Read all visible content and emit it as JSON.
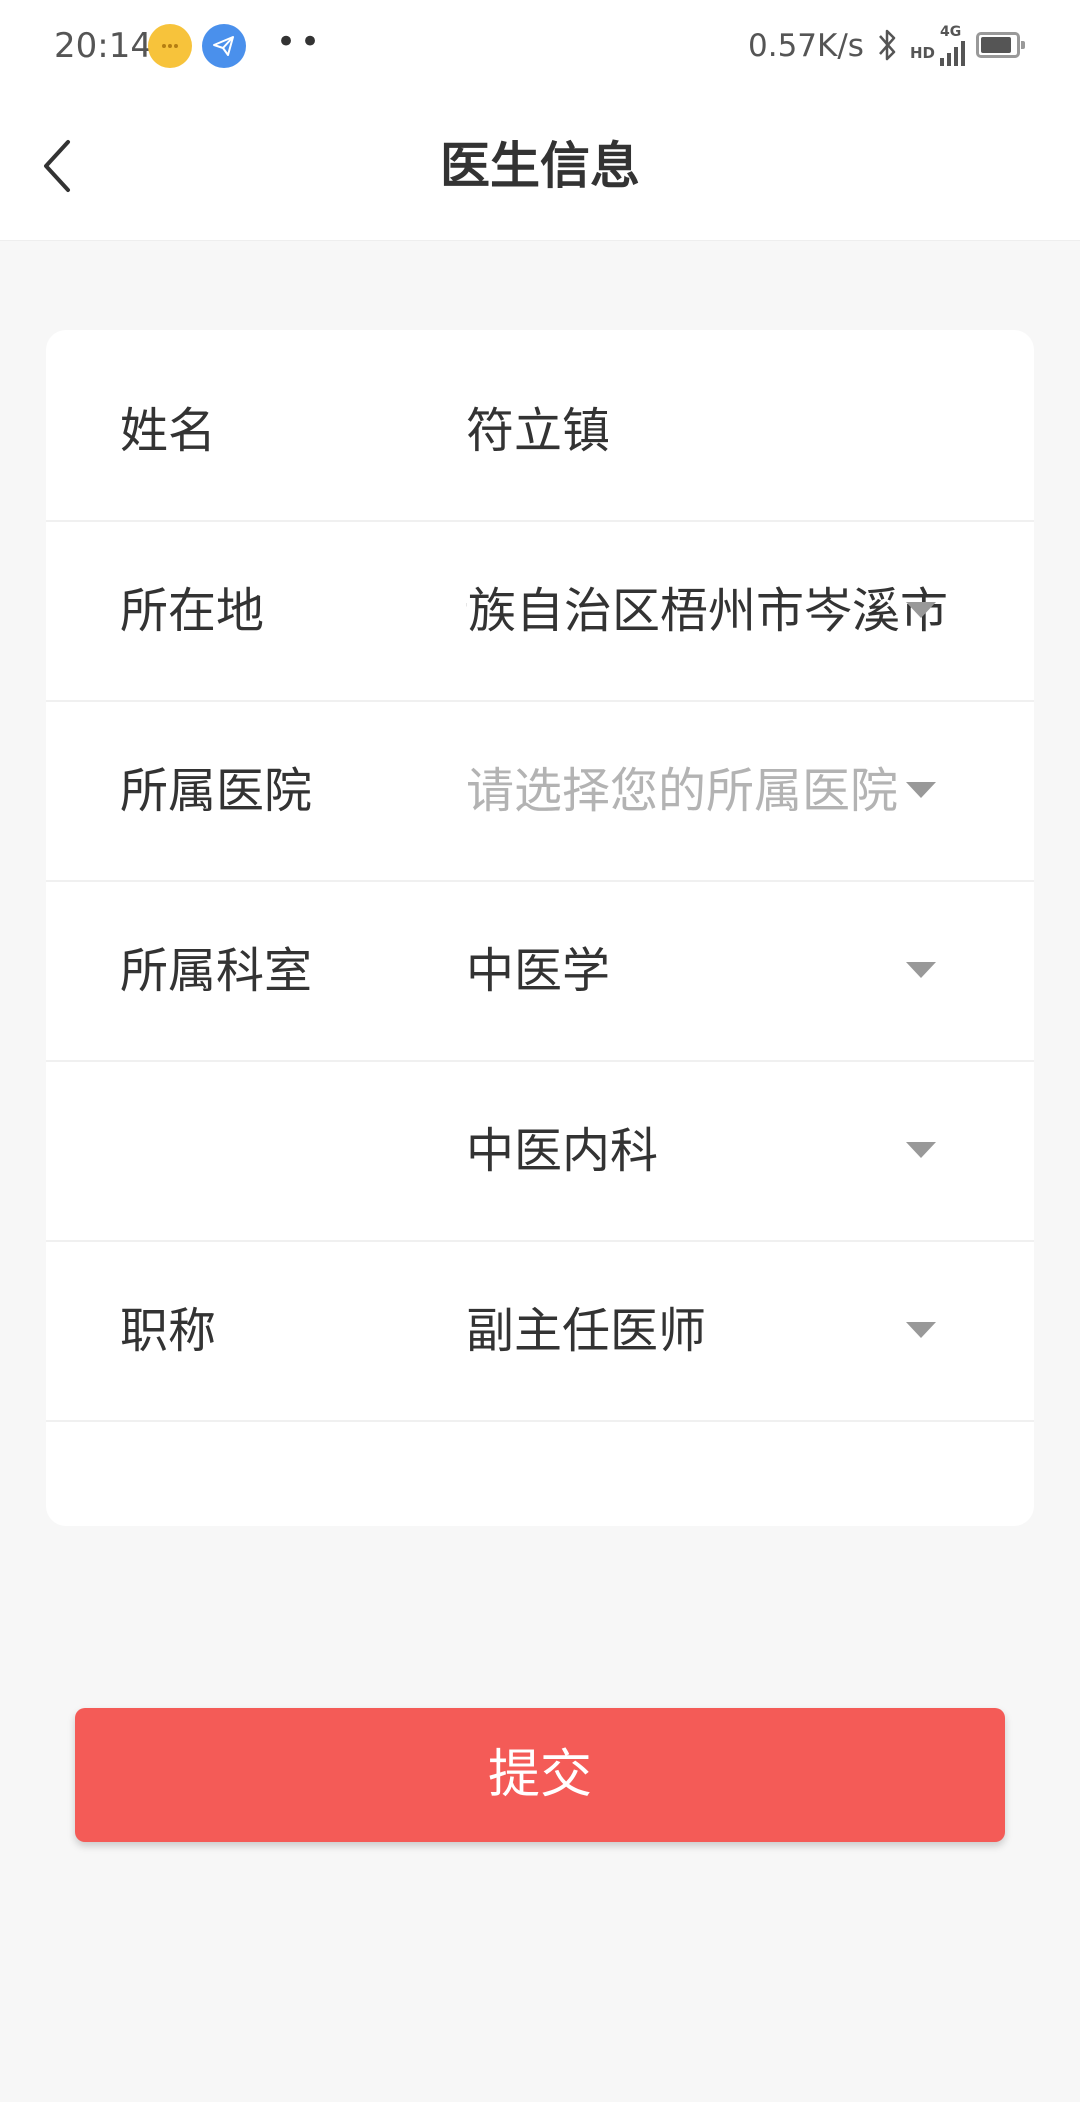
{
  "status_bar": {
    "time": "20:14",
    "net_speed": "0.57K/s",
    "network_hd": "HD",
    "network_gen": "4G",
    "dots": "••",
    "icons": [
      "chat-bubble-icon",
      "telegram-icon",
      "bluetooth-icon",
      "signal-icon",
      "battery-icon"
    ]
  },
  "header": {
    "title": "医生信息",
    "back_icon": "chevron-left-icon"
  },
  "form": {
    "name": {
      "label": "姓名",
      "value": "符立镇"
    },
    "location": {
      "label": "所在地",
      "value": "广西壮族自治区梧州市岑溪市"
    },
    "hospital": {
      "label": "所属医院",
      "placeholder": "请选择您的所属医院"
    },
    "department": {
      "label": "所属科室",
      "value": "中医学"
    },
    "sub_department": {
      "label": "",
      "value": "中医内科"
    },
    "title": {
      "label": "职称",
      "value": "副主任医师"
    }
  },
  "submit_label": "提交",
  "colors": {
    "accent": "#f45b57",
    "background": "#f7f7f7",
    "placeholder": "#b3b3b3",
    "arrow": "#999999"
  }
}
